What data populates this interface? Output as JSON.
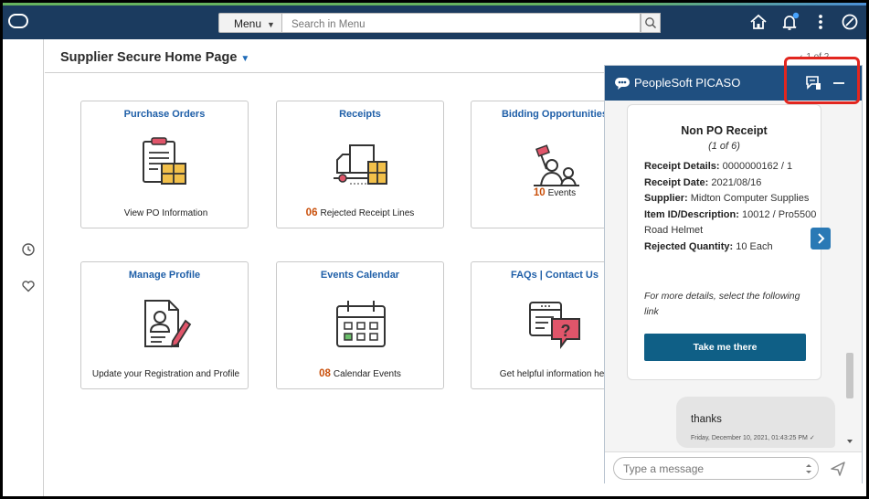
{
  "topbar": {
    "menu_label": "Menu",
    "search_placeholder": "Search in Menu"
  },
  "page": {
    "title": "Supplier Secure Home Page",
    "pager": "1 of 2"
  },
  "tiles": [
    {
      "title": "Purchase Orders",
      "count": "",
      "footer": "View PO Information",
      "icon": "purchase-orders-icon"
    },
    {
      "title": "Receipts",
      "count": "06",
      "footer": "Rejected Receipt Lines",
      "icon": "delivery-truck-icon"
    },
    {
      "title": "Bidding Opportunities",
      "count": "10",
      "footer": "Events",
      "icon": "bidding-person-icon"
    },
    {
      "title": "Manage Profile",
      "count": "",
      "footer": "Update your Registration and Profile",
      "icon": "profile-document-icon"
    },
    {
      "title": "Events Calendar",
      "count": "08",
      "footer": "Calendar Events",
      "icon": "calendar-icon"
    },
    {
      "title": "FAQs | Contact Us",
      "count": "",
      "footer": "Get helpful information here",
      "icon": "help-chat-icon"
    }
  ],
  "chat": {
    "title": "PeopleSoft PICASO",
    "card": {
      "title": "Non PO Receipt",
      "subtitle": "(1 of 6)",
      "fields": [
        {
          "label": "Receipt Details:",
          "value": "0000000162 / 1"
        },
        {
          "label": "Receipt Date:",
          "value": "2021/08/16"
        },
        {
          "label": "Supplier:",
          "value": "Midton Computer Supplies"
        },
        {
          "label": "Item ID/Description:",
          "value": "10012 / Pro5500 Road Helmet"
        },
        {
          "label": "Rejected Quantity:",
          "value": "10 Each"
        }
      ],
      "note": "For more details, select the following link",
      "button": "Take me there"
    },
    "user_message": "thanks",
    "user_timestamp": "Friday, December 10, 2021, 01:43:25 PM ✓",
    "input_placeholder": "Type a message"
  },
  "colors": {
    "topbar": "#1b3b5f",
    "chat_header": "#1f4f80",
    "tile_title": "#1f5fa8",
    "count": "#c94f0a",
    "primary_button": "#0f5f86",
    "highlight": "#e2261f"
  }
}
